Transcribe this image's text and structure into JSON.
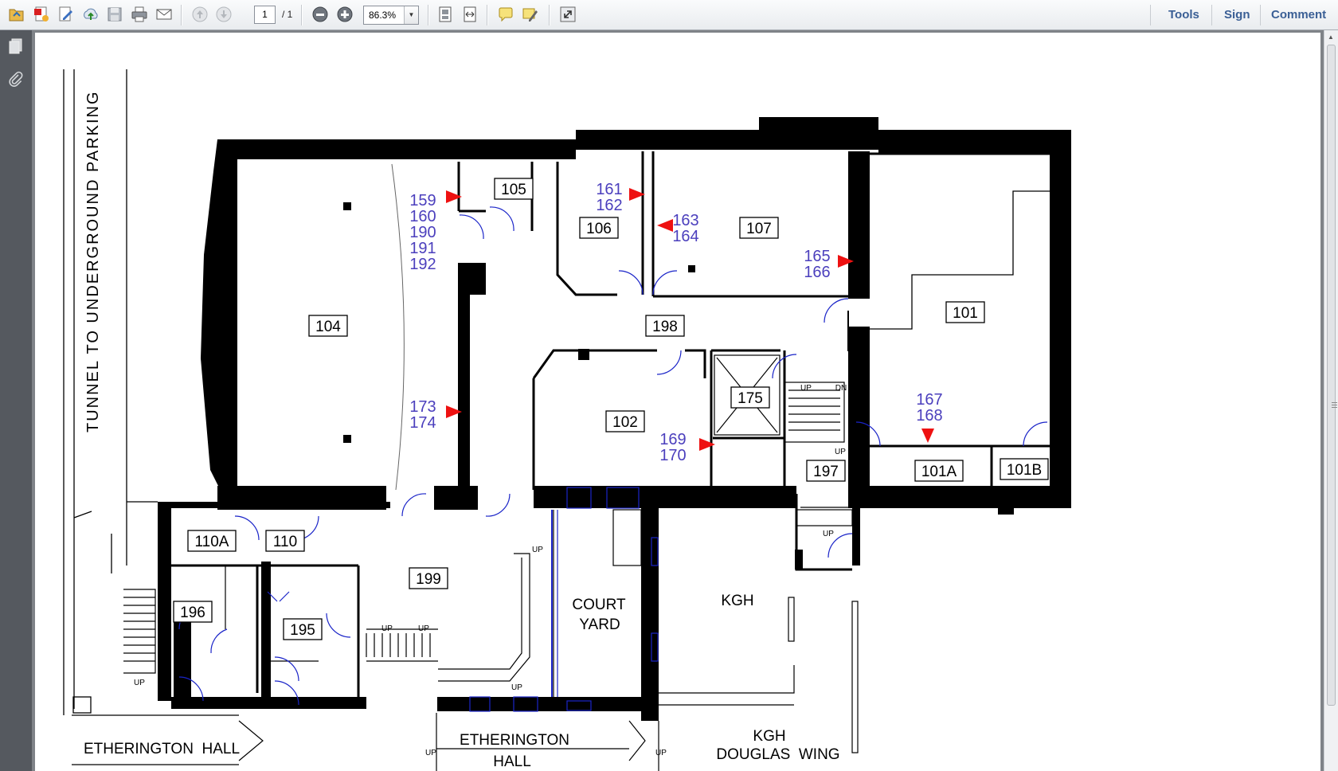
{
  "toolbar": {
    "buttons": [
      "open-icon",
      "create-pdf-icon",
      "edit-icon",
      "upload-icon",
      "save-icon",
      "print-icon",
      "email-icon",
      "previous-page-icon",
      "next-page-icon",
      "zoom-out-icon",
      "zoom-in-icon",
      "fit-page-icon",
      "fit-width-icon",
      "comment-icon",
      "highlight-icon",
      "full-screen-icon"
    ],
    "page_current": "1",
    "page_total": "/ 1",
    "zoom": "86.3%",
    "tools_label": "Tools",
    "sign_label": "Sign",
    "comment_label": "Comment",
    "accent_color": "#3a5f95"
  },
  "sidebar": {
    "icons": [
      "pages-icon",
      "attachment-icon"
    ]
  },
  "floorplan": {
    "tunnel_label": "TUNNEL TO UNDERGROUND PARKING",
    "rooms": [
      "104",
      "105",
      "106",
      "107",
      "101",
      "198",
      "102",
      "175",
      "197",
      "101A",
      "101B",
      "110A",
      "110",
      "199",
      "196",
      "195"
    ],
    "court_yard": [
      "COURT",
      "YARD"
    ],
    "kgh": "KGH",
    "kgh_douglas": [
      "KGH",
      "DOUGLAS  WING"
    ],
    "etherington_left": "ETHERINGTON  HALL",
    "etherington_bottom": [
      "ETHERINGTON",
      "HALL"
    ],
    "stair_labels": {
      "up": "UP",
      "dn": "DN"
    },
    "marker_groups": [
      [
        "159",
        "160",
        "190",
        "191",
        "192"
      ],
      [
        "161",
        "162"
      ],
      [
        "163",
        "164"
      ],
      [
        "165",
        "166"
      ],
      [
        "173",
        "174"
      ],
      [
        "169",
        "170"
      ],
      [
        "167",
        "168"
      ]
    ],
    "marker_color": "#ee1111",
    "number_color": "#4b3fbd"
  }
}
